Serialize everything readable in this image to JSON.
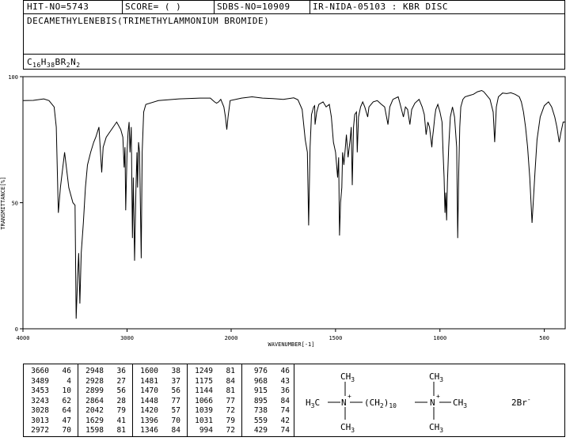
{
  "header": {
    "hit_no": "HIT-NO=5743",
    "score": "SCORE=  (   )",
    "sdbs_no": "SDBS-NO=10909",
    "ir_info": "IR-NIDA-05103 : KBR DISC",
    "compound_name": "DECAMETHYLENEBIS(TRIMETHYLAMMONIUM BROMIDE)",
    "formula_parts": [
      "C",
      "16",
      "H",
      "38",
      "BR",
      "2",
      "N",
      "2"
    ]
  },
  "chart_data": {
    "type": "line",
    "xlabel": "WAVENUMBER[-1]",
    "ylabel": "TRANSMITTANCE[%]",
    "xlim": [
      4000,
      400
    ],
    "ylim": [
      0,
      100
    ],
    "x_ticks": [
      4000,
      3000,
      2000,
      1500,
      1000,
      500
    ],
    "y_ticks": [
      0,
      50,
      100
    ],
    "series": [
      {
        "points": [
          [
            4000,
            90.5
          ],
          [
            3900,
            90.6
          ],
          [
            3800,
            91.2
          ],
          [
            3750,
            90.5
          ],
          [
            3700,
            88
          ],
          [
            3680,
            80
          ],
          [
            3660,
            46
          ],
          [
            3640,
            56
          ],
          [
            3600,
            70
          ],
          [
            3560,
            56
          ],
          [
            3520,
            50
          ],
          [
            3500,
            49
          ],
          [
            3489,
            4
          ],
          [
            3475,
            20
          ],
          [
            3465,
            30
          ],
          [
            3453,
            10
          ],
          [
            3440,
            30
          ],
          [
            3420,
            42
          ],
          [
            3400,
            56
          ],
          [
            3380,
            65
          ],
          [
            3350,
            70
          ],
          [
            3320,
            74
          ],
          [
            3300,
            76
          ],
          [
            3270,
            80
          ],
          [
            3243,
            62
          ],
          [
            3230,
            72
          ],
          [
            3200,
            76
          ],
          [
            3150,
            79
          ],
          [
            3100,
            82
          ],
          [
            3060,
            79
          ],
          [
            3040,
            76
          ],
          [
            3028,
            64
          ],
          [
            3020,
            72
          ],
          [
            3013,
            47
          ],
          [
            3000,
            70
          ],
          [
            2990,
            78
          ],
          [
            2980,
            82
          ],
          [
            2972,
            70
          ],
          [
            2960,
            80
          ],
          [
            2948,
            36
          ],
          [
            2940,
            60
          ],
          [
            2928,
            27
          ],
          [
            2915,
            55
          ],
          [
            2905,
            70
          ],
          [
            2899,
            56
          ],
          [
            2890,
            74
          ],
          [
            2880,
            70
          ],
          [
            2864,
            28
          ],
          [
            2855,
            70
          ],
          [
            2840,
            86
          ],
          [
            2820,
            89
          ],
          [
            2700,
            90.5
          ],
          [
            2500,
            91.2
          ],
          [
            2300,
            91.5
          ],
          [
            2200,
            91.5
          ],
          [
            2160,
            90
          ],
          [
            2140,
            89.5
          ],
          [
            2120,
            90
          ],
          [
            2100,
            91
          ],
          [
            2070,
            88
          ],
          [
            2055,
            84
          ],
          [
            2042,
            79
          ],
          [
            2030,
            84
          ],
          [
            2010,
            90.5
          ],
          [
            1950,
            91.5
          ],
          [
            1900,
            92
          ],
          [
            1850,
            91.5
          ],
          [
            1800,
            91.3
          ],
          [
            1750,
            91
          ],
          [
            1700,
            91.6
          ],
          [
            1680,
            90.8
          ],
          [
            1660,
            87
          ],
          [
            1645,
            75
          ],
          [
            1635,
            70
          ],
          [
            1629,
            41
          ],
          [
            1622,
            72
          ],
          [
            1615,
            85
          ],
          [
            1605,
            88
          ],
          [
            1600,
            88.5
          ],
          [
            1598,
            81
          ],
          [
            1590,
            86
          ],
          [
            1580,
            89
          ],
          [
            1560,
            90
          ],
          [
            1545,
            88
          ],
          [
            1530,
            89
          ],
          [
            1520,
            84
          ],
          [
            1510,
            74
          ],
          [
            1500,
            70
          ],
          [
            1490,
            60
          ],
          [
            1485,
            68
          ],
          [
            1481,
            37
          ],
          [
            1476,
            50
          ],
          [
            1470,
            56
          ],
          [
            1466,
            70
          ],
          [
            1460,
            65
          ],
          [
            1453,
            72
          ],
          [
            1448,
            77
          ],
          [
            1440,
            68
          ],
          [
            1430,
            75
          ],
          [
            1425,
            80
          ],
          [
            1420,
            57
          ],
          [
            1414,
            80
          ],
          [
            1408,
            85
          ],
          [
            1400,
            86
          ],
          [
            1396,
            70
          ],
          [
            1390,
            84
          ],
          [
            1380,
            88
          ],
          [
            1370,
            90
          ],
          [
            1360,
            88
          ],
          [
            1346,
            84
          ],
          [
            1340,
            88
          ],
          [
            1320,
            90
          ],
          [
            1300,
            90.5
          ],
          [
            1280,
            89
          ],
          [
            1265,
            88
          ],
          [
            1249,
            81
          ],
          [
            1240,
            88
          ],
          [
            1225,
            91
          ],
          [
            1200,
            92
          ],
          [
            1190,
            89
          ],
          [
            1175,
            84
          ],
          [
            1165,
            88
          ],
          [
            1155,
            87
          ],
          [
            1144,
            81
          ],
          [
            1135,
            87
          ],
          [
            1120,
            89.5
          ],
          [
            1100,
            91
          ],
          [
            1085,
            88
          ],
          [
            1075,
            85
          ],
          [
            1066,
            77
          ],
          [
            1058,
            82
          ],
          [
            1050,
            80
          ],
          [
            1039,
            72
          ],
          [
            1035,
            76
          ],
          [
            1031,
            79
          ],
          [
            1025,
            84
          ],
          [
            1020,
            87
          ],
          [
            1010,
            89
          ],
          [
            1000,
            86
          ],
          [
            990,
            82
          ],
          [
            985,
            70
          ],
          [
            980,
            60
          ],
          [
            976,
            46
          ],
          [
            972,
            54
          ],
          [
            968,
            43
          ],
          [
            964,
            58
          ],
          [
            958,
            72
          ],
          [
            950,
            84
          ],
          [
            940,
            88
          ],
          [
            930,
            84
          ],
          [
            920,
            72
          ],
          [
            915,
            36
          ],
          [
            910,
            62
          ],
          [
            905,
            80
          ],
          [
            900,
            88
          ],
          [
            890,
            91
          ],
          [
            880,
            92
          ],
          [
            860,
            92.5
          ],
          [
            840,
            93
          ],
          [
            820,
            94
          ],
          [
            800,
            94.5
          ],
          [
            790,
            94
          ],
          [
            780,
            93
          ],
          [
            760,
            91
          ],
          [
            745,
            86
          ],
          [
            738,
            74
          ],
          [
            730,
            88
          ],
          [
            720,
            92
          ],
          [
            700,
            93.5
          ],
          [
            680,
            93.3
          ],
          [
            660,
            93.6
          ],
          [
            640,
            93
          ],
          [
            620,
            92
          ],
          [
            610,
            90
          ],
          [
            600,
            86
          ],
          [
            590,
            80
          ],
          [
            580,
            72
          ],
          [
            570,
            60
          ],
          [
            565,
            52
          ],
          [
            559,
            42
          ],
          [
            553,
            50
          ],
          [
            545,
            62
          ],
          [
            535,
            75
          ],
          [
            520,
            84
          ],
          [
            500,
            88.5
          ],
          [
            480,
            90
          ],
          [
            465,
            88
          ],
          [
            450,
            84
          ],
          [
            440,
            80
          ],
          [
            429,
            74
          ],
          [
            420,
            78
          ],
          [
            410,
            82
          ],
          [
            400,
            82
          ]
        ]
      }
    ]
  },
  "peak_table": {
    "columns": [
      [
        [
          "3660",
          "46"
        ],
        [
          "3489",
          "4"
        ],
        [
          "3453",
          "10"
        ],
        [
          "3243",
          "62"
        ],
        [
          "3028",
          "64"
        ],
        [
          "3013",
          "47"
        ],
        [
          "2972",
          "70"
        ]
      ],
      [
        [
          "2948",
          "36"
        ],
        [
          "2928",
          "27"
        ],
        [
          "2899",
          "56"
        ],
        [
          "2864",
          "28"
        ],
        [
          "2042",
          "79"
        ],
        [
          "1629",
          "41"
        ],
        [
          "1598",
          "81"
        ]
      ],
      [
        [
          "1600",
          "38"
        ],
        [
          "1481",
          "37"
        ],
        [
          "1470",
          "56"
        ],
        [
          "1448",
          "77"
        ],
        [
          "1420",
          "57"
        ],
        [
          "1396",
          "70"
        ],
        [
          "1346",
          "84"
        ]
      ],
      [
        [
          "1249",
          "81"
        ],
        [
          "1175",
          "84"
        ],
        [
          "1144",
          "81"
        ],
        [
          "1066",
          "77"
        ],
        [
          "1039",
          "72"
        ],
        [
          "1031",
          "79"
        ],
        [
          "994",
          "72"
        ]
      ],
      [
        [
          "976",
          "46"
        ],
        [
          "968",
          "43"
        ],
        [
          "915",
          "36"
        ],
        [
          "895",
          "84"
        ],
        [
          "738",
          "74"
        ],
        [
          "559",
          "42"
        ],
        [
          "429",
          "74"
        ]
      ]
    ]
  },
  "structure": {
    "top_left": "CH",
    "top_left_sub": "3",
    "top_right": "CH",
    "top_right_sub": "3",
    "bottom_left": "CH",
    "bottom_left_sub": "3",
    "bottom_right": "CH",
    "bottom_right_sub": "3",
    "left_h": "H",
    "left_h_sub": "3",
    "left_c": "C",
    "n_left": "N",
    "chain_open": "(CH",
    "chain_sub2": "2",
    "chain_close": ")",
    "chain_sub10": "10",
    "n_right": "N",
    "right_ch": "CH",
    "right_ch_sub": "3",
    "plus": "+",
    "counter_ion": "2Br",
    "counter_minus": "-"
  }
}
